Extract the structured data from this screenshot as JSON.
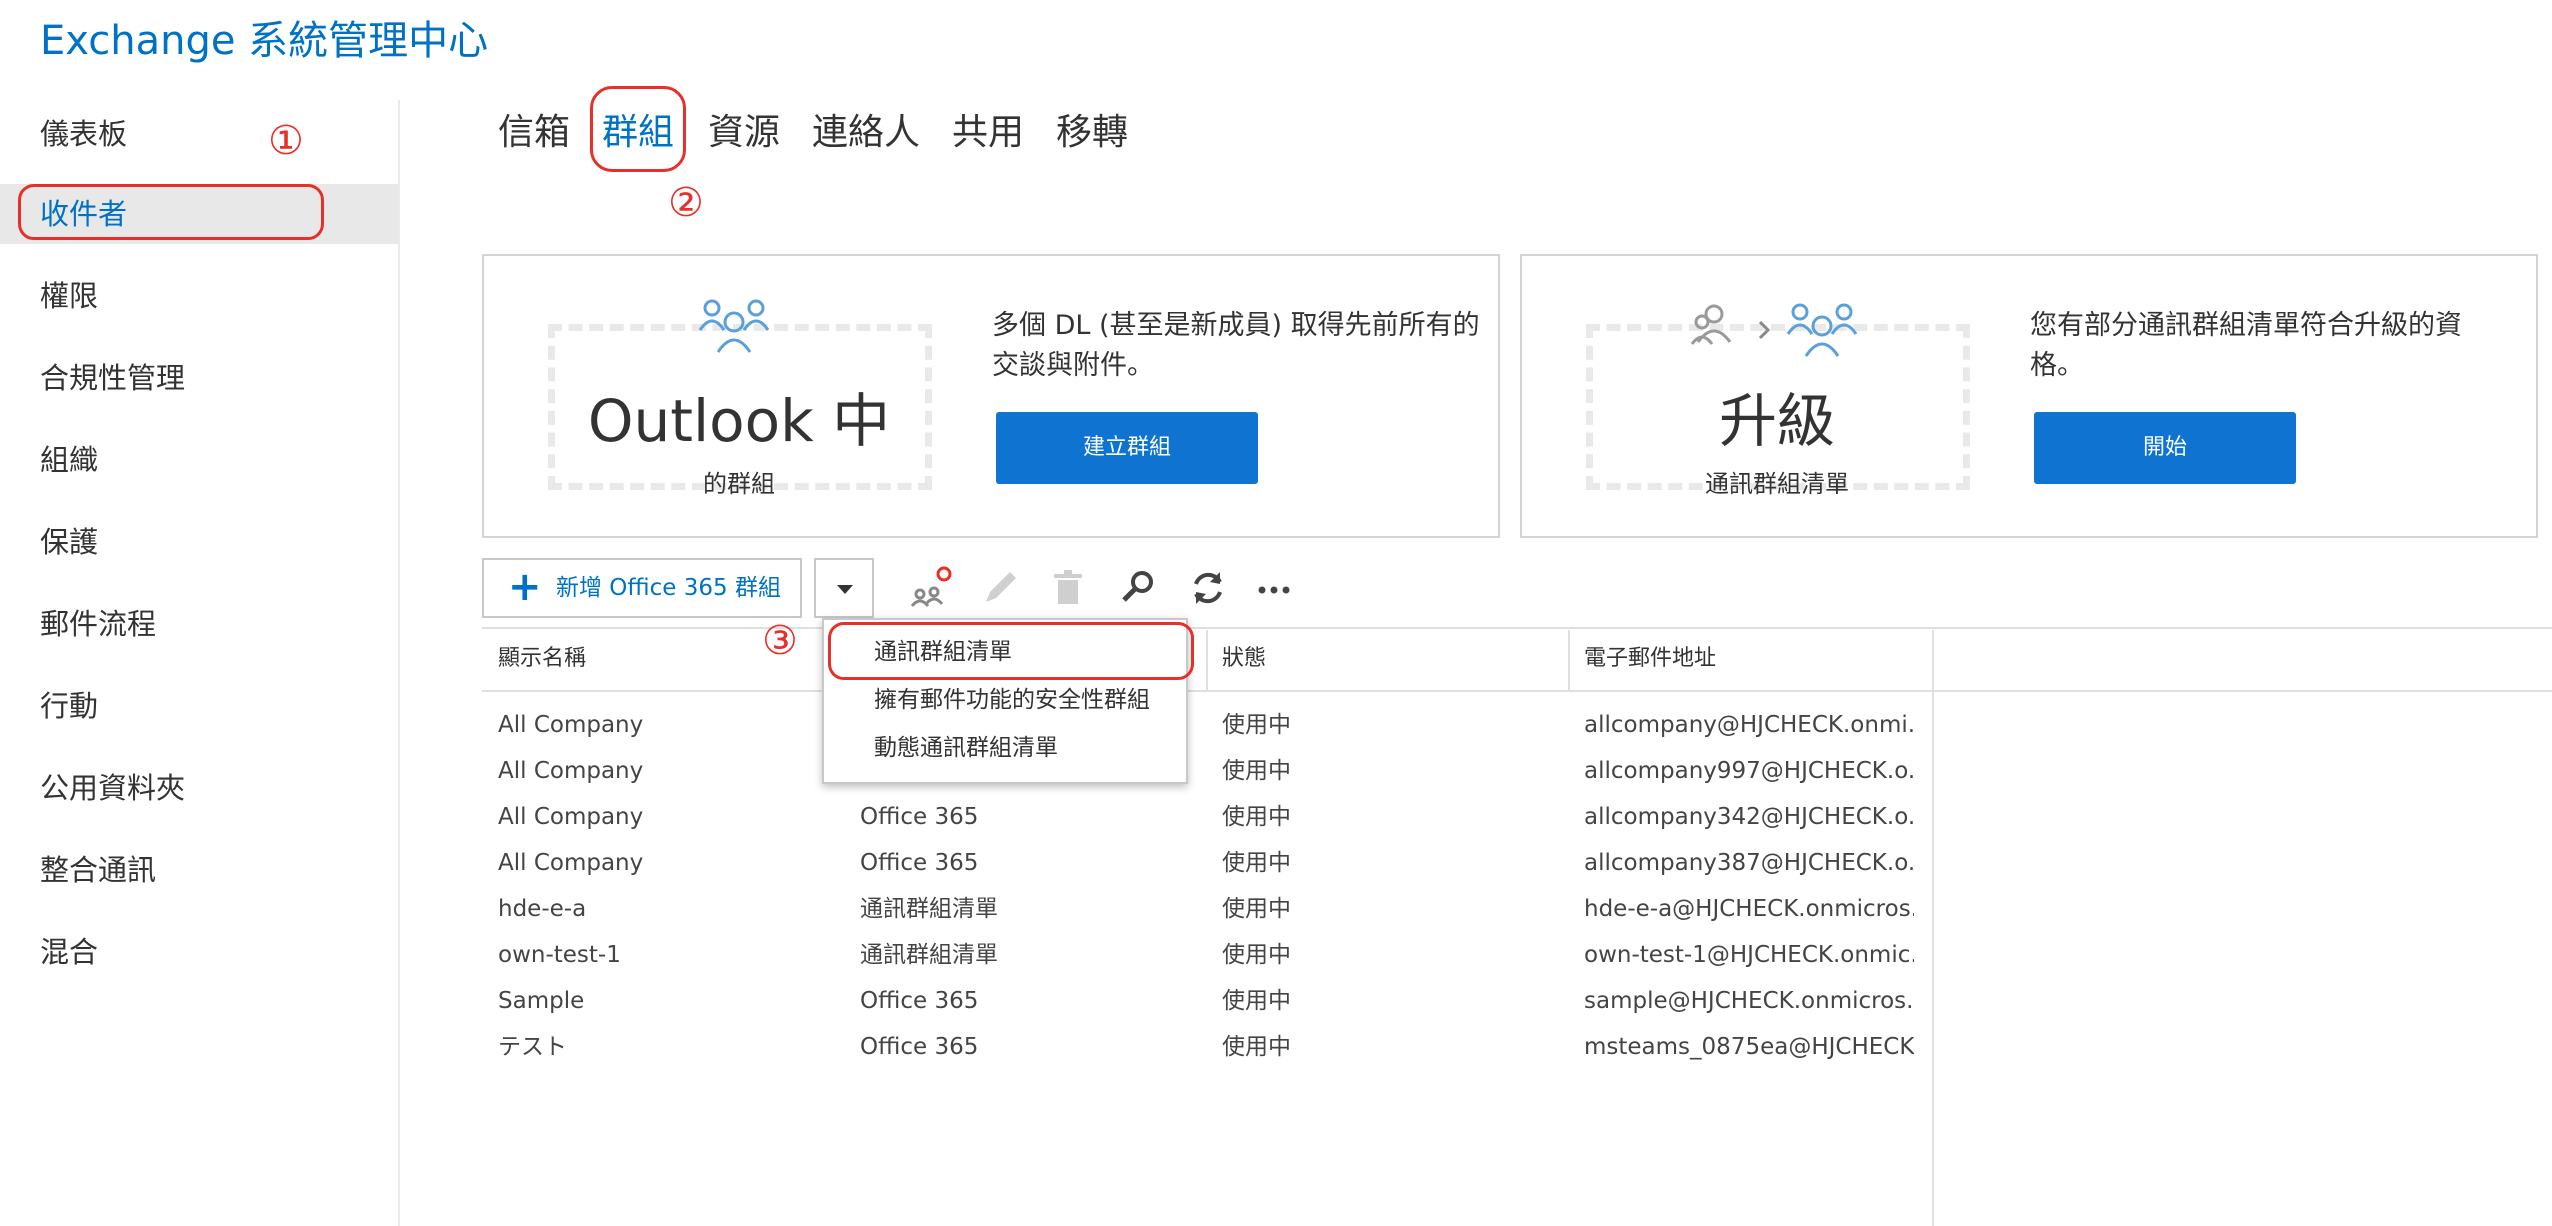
{
  "app_title": "Exchange 系統管理中心",
  "sidebar": {
    "items": [
      {
        "label": "儀表板"
      },
      {
        "label": "收件者"
      },
      {
        "label": "權限"
      },
      {
        "label": "合規性管理"
      },
      {
        "label": "組織"
      },
      {
        "label": "保護"
      },
      {
        "label": "郵件流程"
      },
      {
        "label": "行動"
      },
      {
        "label": "公用資料夾"
      },
      {
        "label": "整合通訊"
      },
      {
        "label": "混合"
      }
    ],
    "active_index": 1
  },
  "annotations": {
    "step1": "①",
    "step2": "②",
    "step3": "③"
  },
  "tabs": [
    {
      "label": "信箱"
    },
    {
      "label": "群組"
    },
    {
      "label": "資源"
    },
    {
      "label": "連絡人"
    },
    {
      "label": "共用"
    },
    {
      "label": "移轉"
    }
  ],
  "cards": {
    "outlook": {
      "big_text": "Outlook 中",
      "small_text": "的群組",
      "description": "多個 DL (甚至是新成員) 取得先前所有的交談與附件。",
      "button": "建立群組"
    },
    "upgrade": {
      "big_text": "升級",
      "small_text": "通訊群組清單",
      "description": "您有部分通訊群組清單符合升級的資格。",
      "button": "開始"
    }
  },
  "toolbar": {
    "new_button": "新增 Office 365 群組",
    "icons": [
      "group-settings-icon",
      "edit-icon",
      "delete-icon",
      "search-icon",
      "refresh-icon",
      "more-icon"
    ]
  },
  "dropdown_menu": {
    "items": [
      "通訊群組清單",
      "擁有郵件功能的安全性群組",
      "動態通訊群組清單"
    ]
  },
  "table": {
    "columns": [
      "顯示名稱",
      "",
      "狀態",
      "電子郵件地址"
    ],
    "rows": [
      {
        "name": "All Company",
        "type": "",
        "status": "使用中",
        "email": "allcompany@HJCHECK.onmi..."
      },
      {
        "name": "All Company",
        "type": "",
        "status": "使用中",
        "email": "allcompany997@HJCHECK.o..."
      },
      {
        "name": "All Company",
        "type": "Office 365",
        "status": "使用中",
        "email": "allcompany342@HJCHECK.o..."
      },
      {
        "name": "All Company",
        "type": "Office 365",
        "status": "使用中",
        "email": "allcompany387@HJCHECK.o..."
      },
      {
        "name": "hde-e-a",
        "type": "通訊群組清單",
        "status": "使用中",
        "email": "hde-e-a@HJCHECK.onmicros..."
      },
      {
        "name": "own-test-1",
        "type": "通訊群組清單",
        "status": "使用中",
        "email": "own-test-1@HJCHECK.onmic..."
      },
      {
        "name": "Sample",
        "type": "Office 365",
        "status": "使用中",
        "email": "sample@HJCHECK.onmicros..."
      },
      {
        "name": "テスト",
        "type": "Office 365",
        "status": "使用中",
        "email": "msteams_0875ea@HJCHECK...."
      }
    ]
  },
  "colors": {
    "accent": "#0072c6",
    "button": "#0f74d1",
    "annotation": "#e8302a"
  }
}
